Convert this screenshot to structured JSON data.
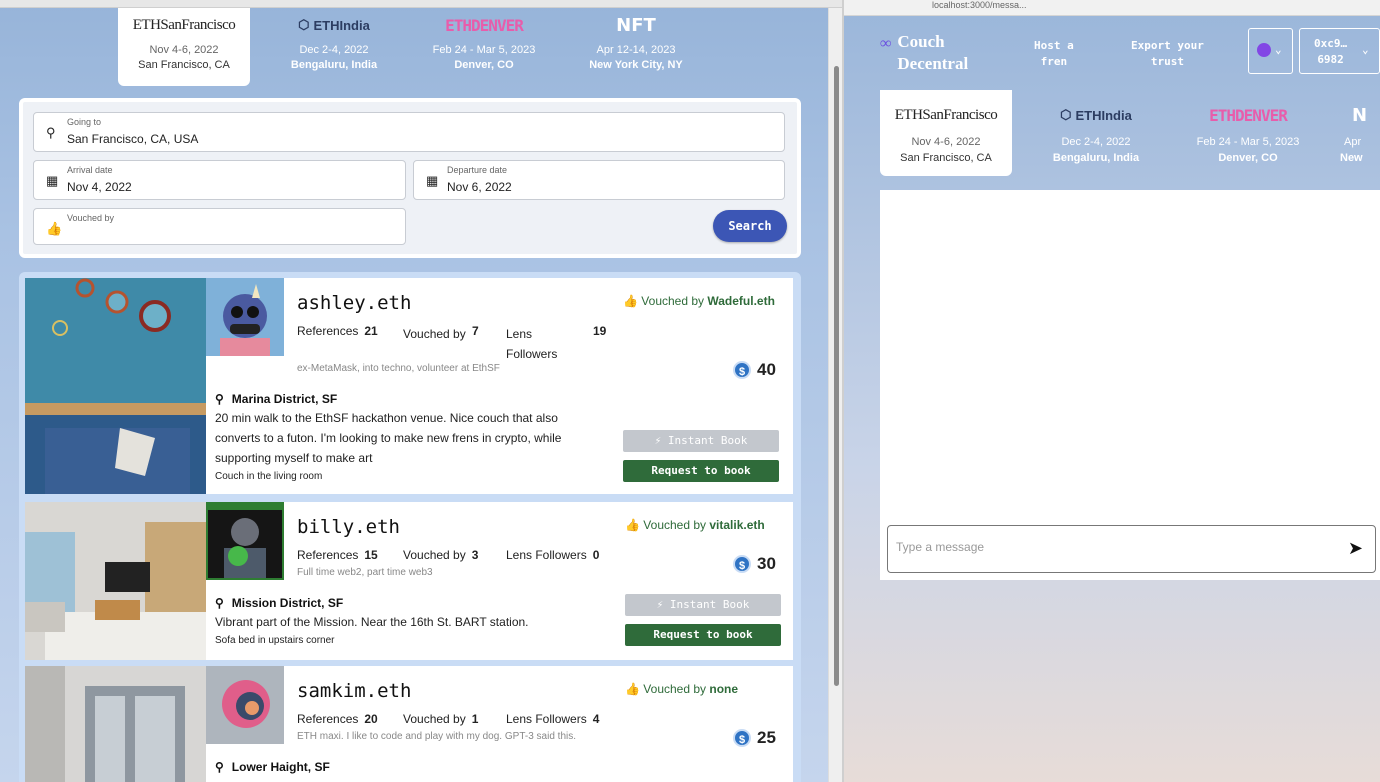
{
  "events": [
    {
      "logo": "ETHSanFrancisco",
      "dates": "Nov 4-6, 2022",
      "city": "San Francisco, CA",
      "active": true
    },
    {
      "logo": "ETHIndia",
      "dates": "Dec 2-4, 2022",
      "city": "Bengaluru, India"
    },
    {
      "logo": "ETHDENVER",
      "dates": "Feb 24 - Mar 5, 2023",
      "city": "Denver, CO"
    },
    {
      "logo": "NFT",
      "dates": "Apr 12-14, 2023",
      "city": "New York City, NY"
    }
  ],
  "search": {
    "going_label": "Going to",
    "going_value": "San Francisco, CA, USA",
    "arrival_label": "Arrival date",
    "arrival_value": "Nov 4, 2022",
    "departure_label": "Departure date",
    "departure_value": "Nov 6, 2022",
    "vouched_label": "Vouched by",
    "vouched_value": "",
    "button": "Search"
  },
  "listings": [
    {
      "name": "ashley.eth",
      "refs_label": "References",
      "refs": "21",
      "vouched_label": "Vouched by",
      "vouched": "7",
      "lens_label": "Lens Followers",
      "lens": "19",
      "bio": "ex-MetaMask, into techno, volunteer at EthSF",
      "vouch_prefix": "Vouched by",
      "vouch_name": "Wadeful.eth",
      "price": "40",
      "location": "Marina District, SF",
      "description": "20 min walk to the EthSF hackathon venue. Nice couch that also converts to a futon. I'm looking to make new frens in crypto, while supporting myself to make art",
      "sleep": "Couch in the living room",
      "instant": "Instant Book",
      "request": "Request to book"
    },
    {
      "name": "billy.eth",
      "refs_label": "References",
      "refs": "15",
      "vouched_label": "Vouched by",
      "vouched": "3",
      "lens_label": "Lens Followers",
      "lens": "0",
      "bio": "Full time web2, part time web3",
      "vouch_prefix": "Vouched by",
      "vouch_name": "vitalik.eth",
      "price": "30",
      "location": "Mission District, SF",
      "description": "Vibrant part of the Mission. Near the 16th St. BART station.",
      "sleep": "Sofa bed in upstairs corner",
      "instant": "Instant Book",
      "request": "Request to book"
    },
    {
      "name": "samkim.eth",
      "refs_label": "References",
      "refs": "20",
      "vouched_label": "Vouched by",
      "vouched": "1",
      "lens_label": "Lens Followers",
      "lens": "4",
      "bio": "ETH maxi. I like to code and play with my dog. GPT-3 said this.",
      "vouch_prefix": "Vouched by",
      "vouch_name": "none",
      "price": "25",
      "location": "Lower Haight, SF"
    }
  ],
  "right": {
    "url": "localhost:3000/messa...",
    "brand_line1": "Couch",
    "brand_line2": "Decentral",
    "nav_host_1": "Host a",
    "nav_host_2": "fren",
    "nav_export_1": "Export your",
    "nav_export_2": "trust",
    "wallet_1": "0xc9…",
    "wallet_2": "6982",
    "events": [
      {
        "logo": "ETHSanFrancisco",
        "dates": "Nov 4-6, 2022",
        "city": "San Francisco, CA"
      },
      {
        "logo": "ETHIndia",
        "dates": "Dec 2-4, 2022",
        "city": "Bengaluru, India"
      },
      {
        "logo": "ETHDENVER",
        "dates": "Feb 24 - Mar 5, 2023",
        "city": "Denver, CO"
      },
      {
        "logo": "N",
        "dates": "Apr",
        "city": "New"
      }
    ],
    "message_placeholder": "Type a message"
  },
  "colors": {
    "primary": "#3c56b5",
    "vouch_green": "#2f6b3a",
    "disabled": "#c3c7cd",
    "coin": "#2f73c4"
  }
}
